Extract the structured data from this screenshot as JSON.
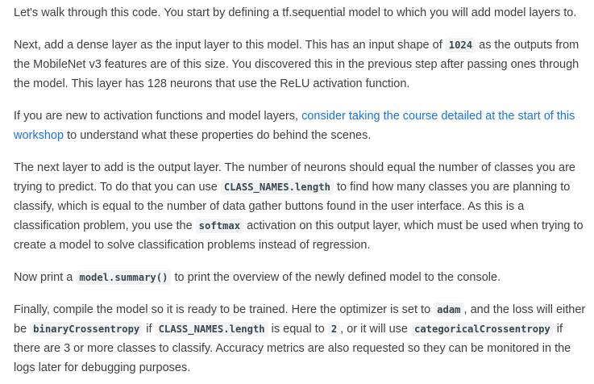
{
  "paragraphs": {
    "p1": {
      "text": "Let's walk through this code. You start by defining a tf.sequential model to which you will add model layers to."
    },
    "p2": {
      "t1": "Next, add a dense layer as the input layer to this model. This has an input shape of ",
      "code1": "1024",
      "t2": " as the outputs from the MobileNet v3 features are of this size. You discovered this in the previous step after passing ones through the model. This layer has 128 neurons that use the ReLU activation function."
    },
    "p3": {
      "t1": "If you are new to activation functions and model layers, ",
      "link": "consider taking the course detailed at the start of this workshop",
      "t2": " to understand what these properties do behind the scenes."
    },
    "p4": {
      "t1": "The next layer to add is the output layer. The number of neurons should equal the number of classes you are trying to predict. To do that you can use ",
      "code1": "CLASS_NAMES.length",
      "t2": " to find how many classes you are planning to classify, which is equal to the number of data gather buttons found in the user interface. As this is a classification problem, you use the ",
      "code2": "softmax",
      "t3": " activation on this output layer, which must be used when trying to create a model to solve classification problems instead of regression."
    },
    "p5": {
      "t1": "Now print a ",
      "code1": "model.summary()",
      "t2": " to print the overview of the newly defined model to the console."
    },
    "p6": {
      "t1": "Finally, compile the model so it is ready to be trained. Here the optimizer is set to ",
      "code1": "adam",
      "t2": ", and the loss will either be ",
      "code2": "binaryCrossentropy",
      "t3": " if ",
      "code3": "CLASS_NAMES.length",
      "t4": " is equal to ",
      "code4": "2",
      "t5": ", or it will use ",
      "code5": "categoricalCrossentropy",
      "t6": " if there are 3 or more classes to classify. Accuracy metrics are also requested so they can be monitored in the logs later for debugging purposes."
    }
  },
  "colors": {
    "text": "#3c4043",
    "link": "#1a73e8",
    "code_background": "#f1f3f4"
  }
}
